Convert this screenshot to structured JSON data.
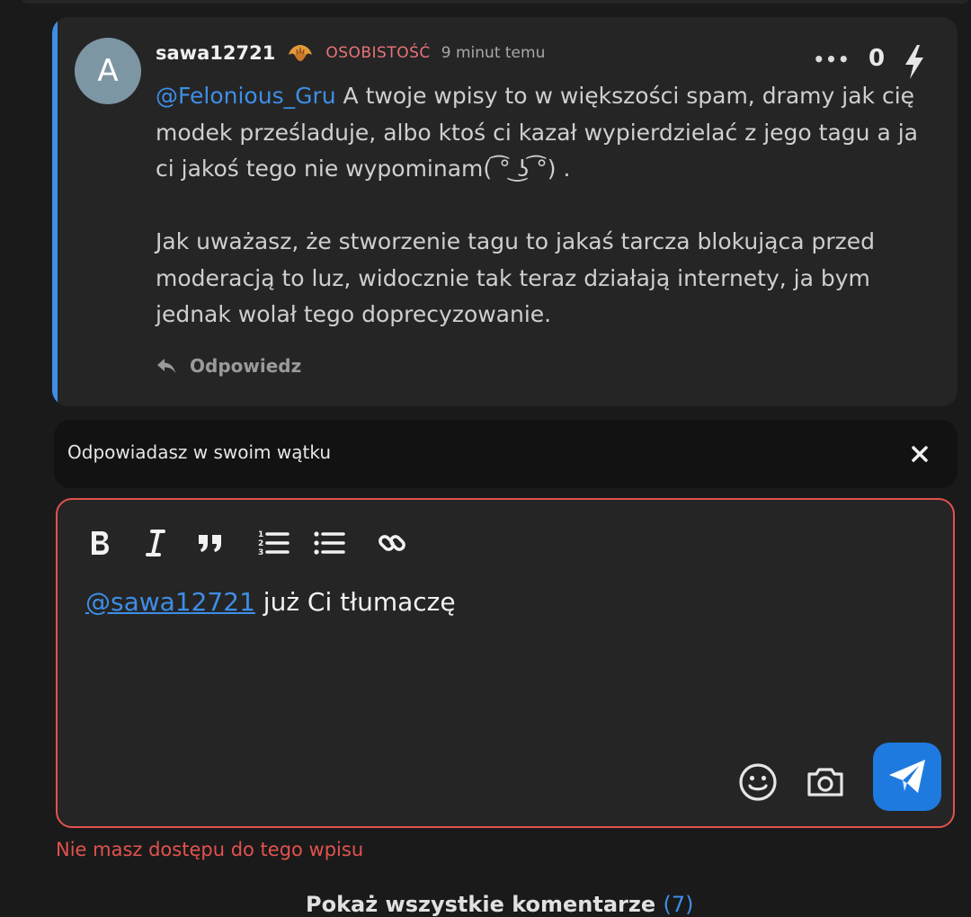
{
  "comment": {
    "avatar_letter": "A",
    "username": "sawa12721",
    "badge_icon": "croissant-icon",
    "badge_label": "OSOBISTOŚĆ",
    "time": "9 minut temu",
    "more_label": "•••",
    "votes": "0",
    "mention": "@Felonious_Gru",
    "text_line1_rest": " A twoje wpisy to w większości spam, dramy jak cię modek prześladuje, albo ktoś ci kazał wypierdzielać z jego tagu a ja ci jakoś tego nie wypominam( ͡° ͜ʖ ͡°) .",
    "text_paragraph2": "Jak uważasz, że stworzenie tagu to jakaś tarcza blokująca przed moderacją to luz, widocznie tak teraz działają internety, ja bym jednak wolał tego doprecyzowanie.",
    "reply_label": "Odpowiedz"
  },
  "reply_banner": {
    "text": "Odpowiadasz w swoim wątku",
    "close_icon": "close-icon"
  },
  "editor": {
    "toolbar": [
      "bold-icon",
      "italic-icon",
      "quote-icon",
      "ordered-list-icon",
      "bullet-list-icon",
      "link-icon"
    ],
    "mention": "@sawa12721",
    "text": " już Ci tłumaczę",
    "emoji_icon": "emoji-icon",
    "camera_icon": "camera-icon",
    "send_icon": "send-icon"
  },
  "error": "Nie masz dostępu do tego wpisu",
  "footer_partial": {
    "text": "Pokaż wszystkie komentarze",
    "count": "(7)"
  },
  "colors": {
    "accent": "#3e8ee6",
    "error": "#e2524d",
    "badge": "#e9737a",
    "send_button": "#1f7ae0"
  }
}
